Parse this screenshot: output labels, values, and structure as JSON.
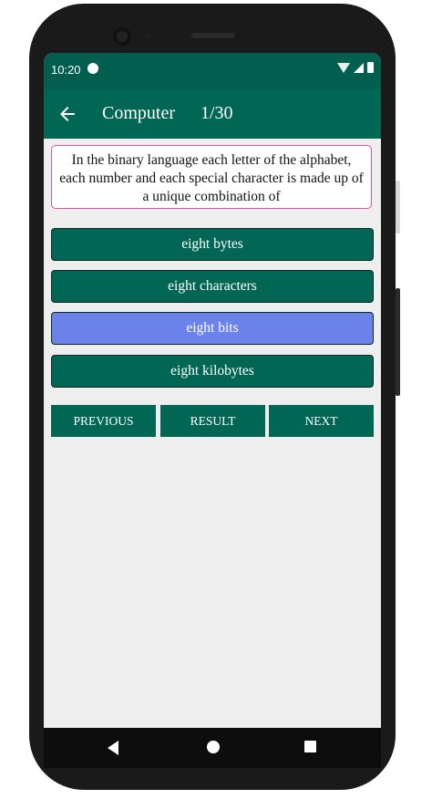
{
  "status_bar": {
    "time": "10:20"
  },
  "app_bar": {
    "title": "Computer",
    "progress": "1/30"
  },
  "question": {
    "text": "In the binary language each letter of the alphabet, each number and each special character is made up of a unique combination of"
  },
  "options": [
    {
      "label": "eight bytes",
      "selected": false
    },
    {
      "label": "eight characters",
      "selected": false
    },
    {
      "label": "eight bits",
      "selected": true
    },
    {
      "label": "eight kilobytes",
      "selected": false
    }
  ],
  "buttons": {
    "previous": "PREVIOUS",
    "result": "RESULT",
    "next": "NEXT"
  },
  "colors": {
    "primary": "#026655",
    "status_bar": "#025f4f",
    "selected": "#6b82ea",
    "question_border": "#e2559a",
    "background": "#eeeeee"
  },
  "icons": {
    "back": "arrow-back-icon",
    "nav_back": "triangle-back-icon",
    "nav_home": "circle-home-icon",
    "nav_recent": "square-recent-icon"
  }
}
